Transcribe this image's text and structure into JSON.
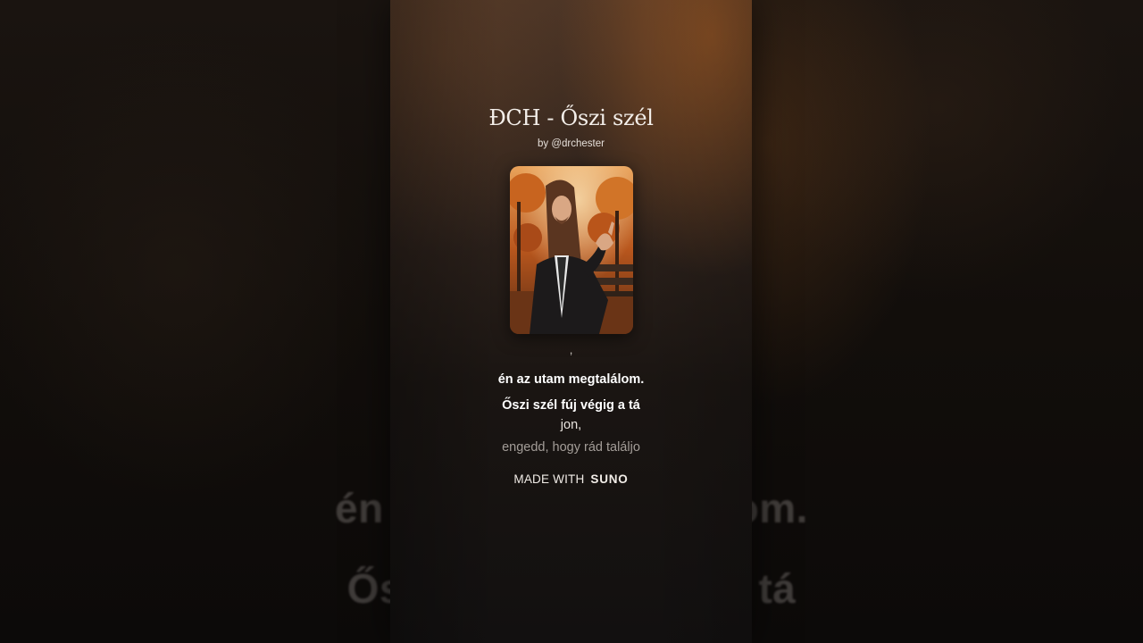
{
  "song": {
    "title": "ĐCH - Őszi szél",
    "byline": "by @drchester"
  },
  "cover": {
    "icon": "album-cover-portrait"
  },
  "lyrics": {
    "prev_fragment": ",",
    "line1": "én az utam megtalálom.",
    "line2": "Őszi szél fúj végig a tá",
    "line3": "jon,",
    "line4": "engedd, hogy rád találjo"
  },
  "branding": {
    "prefix": "MADE WITH",
    "name": "SUNO"
  },
  "background_lyrics": {
    "line1": "én az utam megtalálom.",
    "line2": "Őszi szél fúj végig a tá"
  },
  "colors": {
    "panel_accent": "#96551f",
    "text": "#ffffff",
    "dim_text": "#a39d98"
  }
}
